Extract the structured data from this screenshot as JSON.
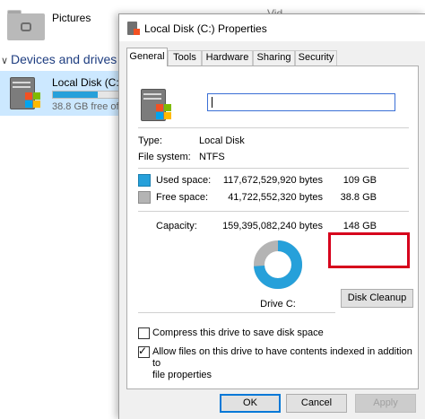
{
  "explorer": {
    "folder_pictures": "Pictures",
    "folder_videos_partial": "Vid",
    "section_title": "Devices and drives (",
    "drive_name": "Local Disk (C:)",
    "drive_free": "38.8 GB free of",
    "drive_used_fraction": 0.69
  },
  "dialog": {
    "title": "Local Disk (C:) Properties",
    "tabs": [
      "General",
      "Tools",
      "Hardware",
      "Sharing",
      "Security"
    ],
    "active_tab": "General",
    "name_value": "",
    "type_label": "Type:",
    "type_value": "Local Disk",
    "fs_label": "File system:",
    "fs_value": "NTFS",
    "used_label": "Used space:",
    "used_bytes": "117,672,529,920 bytes",
    "used_gb": "109 GB",
    "free_label": "Free space:",
    "free_bytes": "41,722,552,320 bytes",
    "free_gb": "38.8 GB",
    "capacity_label": "Capacity:",
    "capacity_bytes": "159,395,082,240 bytes",
    "capacity_gb": "148 GB",
    "used_fraction": 0.738,
    "drive_caption": "Drive C:",
    "cleanup_button": "Disk Cleanup",
    "compress_label": "Compress this drive to save disk space",
    "compress_checked": false,
    "index_label_line1": "Allow files on this drive to have contents indexed in addition to",
    "index_label_line2": "file properties",
    "index_checked": true,
    "ok_button": "OK",
    "cancel_button": "Cancel",
    "apply_button": "Apply",
    "colors": {
      "used": "#26a0da",
      "free": "#b4b4b4",
      "highlight": "#d6001c"
    }
  }
}
